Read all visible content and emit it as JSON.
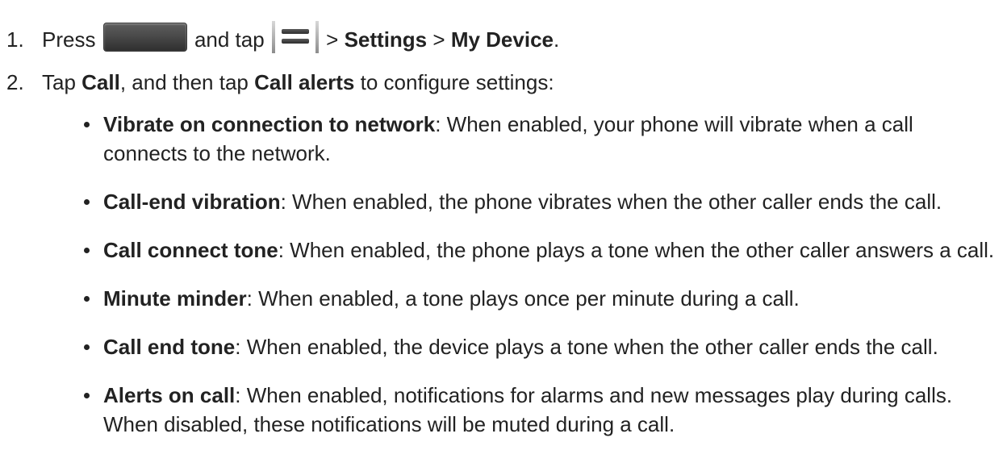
{
  "steps": [
    {
      "number": "1.",
      "t1": "Press",
      "t2": "and tap",
      "t3": ">",
      "settings": "Settings",
      "t4": ">",
      "my_device": "My Device",
      "t5": "."
    },
    {
      "number": "2.",
      "t1": "Tap",
      "call": "Call",
      "t2": ", and then tap",
      "call_alerts": "Call alerts",
      "t3": "to configure settings:"
    }
  ],
  "bullets": [
    {
      "term": "Vibrate on connection to network",
      "text": ": When enabled, your phone will vibrate when a call connects to the network."
    },
    {
      "term": "Call-end vibration",
      "text": ": When enabled, the phone vibrates when the other caller ends the call."
    },
    {
      "term": "Call connect tone",
      "text": ": When enabled, the phone plays a tone when the other caller answers a call."
    },
    {
      "term": "Minute minder",
      "text": ": When enabled, a tone plays once per minute during a call."
    },
    {
      "term": "Call end tone",
      "text": ": When enabled, the device plays a tone when the other caller ends the call."
    },
    {
      "term": "Alerts on call",
      "text": ": When enabled, notifications for alarms and new messages play during calls. When disabled, these notifications will be muted during a call."
    }
  ],
  "icons": {
    "home_key": "home-key-icon",
    "menu_key": "menu-key-icon"
  }
}
